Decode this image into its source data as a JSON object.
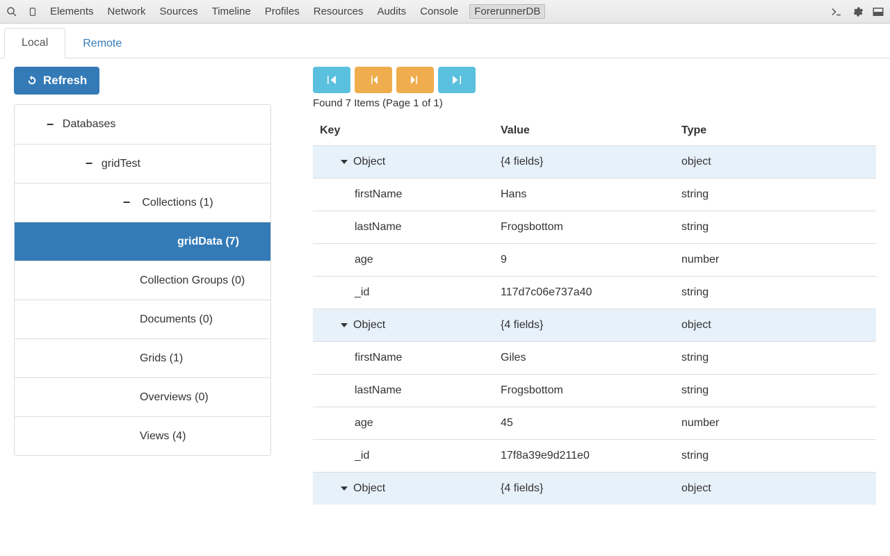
{
  "devtools": {
    "items": [
      "Elements",
      "Network",
      "Sources",
      "Timeline",
      "Profiles",
      "Resources",
      "Audits",
      "Console",
      "ForerunnerDB"
    ],
    "activeIndex": 8
  },
  "tabs": {
    "local": "Local",
    "remote": "Remote"
  },
  "refresh": "Refresh",
  "tree": {
    "databases": "Databases",
    "db": "gridTest",
    "collections": "Collections (1)",
    "gridData": "gridData (7)",
    "collectionGroups": "Collection Groups (0)",
    "documents": "Documents (0)",
    "grids": "Grids (1)",
    "overviews": "Overviews (0)",
    "views": "Views (4)"
  },
  "pager": {
    "found": "Found 7 Items (Page 1 of 1)"
  },
  "table": {
    "headers": {
      "key": "Key",
      "value": "Value",
      "type": "Type"
    },
    "objectLabel": "Object",
    "fieldsLabel": "{4 fields}",
    "objectType": "object",
    "rows": [
      [
        {
          "k": "firstName",
          "v": "Hans",
          "t": "string"
        },
        {
          "k": "lastName",
          "v": "Frogsbottom",
          "t": "string"
        },
        {
          "k": "age",
          "v": "9",
          "t": "number"
        },
        {
          "k": "_id",
          "v": "117d7c06e737a40",
          "t": "string"
        }
      ],
      [
        {
          "k": "firstName",
          "v": "Giles",
          "t": "string"
        },
        {
          "k": "lastName",
          "v": "Frogsbottom",
          "t": "string"
        },
        {
          "k": "age",
          "v": "45",
          "t": "number"
        },
        {
          "k": "_id",
          "v": "17f8a39e9d211e0",
          "t": "string"
        }
      ]
    ]
  }
}
